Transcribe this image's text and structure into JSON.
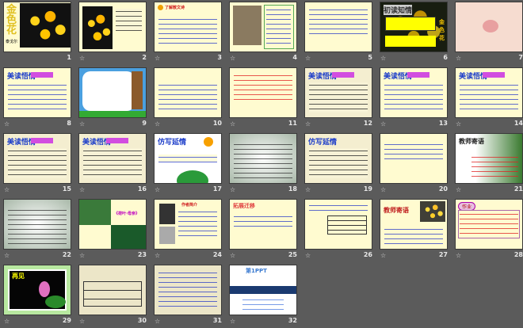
{
  "view": "slide-sorter",
  "slides": [
    {
      "number": "1",
      "title": "金色花",
      "subtitle": "泰戈尔"
    },
    {
      "number": "2"
    },
    {
      "number": "3",
      "title": "了解散文诗"
    },
    {
      "number": "4"
    },
    {
      "number": "5"
    },
    {
      "number": "6",
      "title": "初读知情",
      "side": "金色花"
    },
    {
      "number": "7"
    },
    {
      "number": "8",
      "title": "美读悟情"
    },
    {
      "number": "9"
    },
    {
      "number": "10"
    },
    {
      "number": "11"
    },
    {
      "number": "12",
      "title": "美读悟情"
    },
    {
      "number": "13",
      "title": "美读悟情"
    },
    {
      "number": "14",
      "title": "美读悟情"
    },
    {
      "number": "15",
      "title": "美读悟情"
    },
    {
      "number": "16",
      "title": "美读悟情"
    },
    {
      "number": "17",
      "title": "仿写延情"
    },
    {
      "number": "18"
    },
    {
      "number": "19",
      "title": "仿写延情"
    },
    {
      "number": "20"
    },
    {
      "number": "21",
      "title": "教师寄语"
    },
    {
      "number": "22"
    },
    {
      "number": "23",
      "title": "《荷叶·母亲》"
    },
    {
      "number": "24",
      "title": "作者简介"
    },
    {
      "number": "25",
      "title": "拓展迁移"
    },
    {
      "number": "26"
    },
    {
      "number": "27",
      "title": "教师寄语"
    },
    {
      "number": "28",
      "title": "作业"
    },
    {
      "number": "29",
      "title": "再见"
    },
    {
      "number": "30"
    },
    {
      "number": "31"
    },
    {
      "number": "32",
      "title": "第1PPT"
    }
  ],
  "star_icon": "☆"
}
